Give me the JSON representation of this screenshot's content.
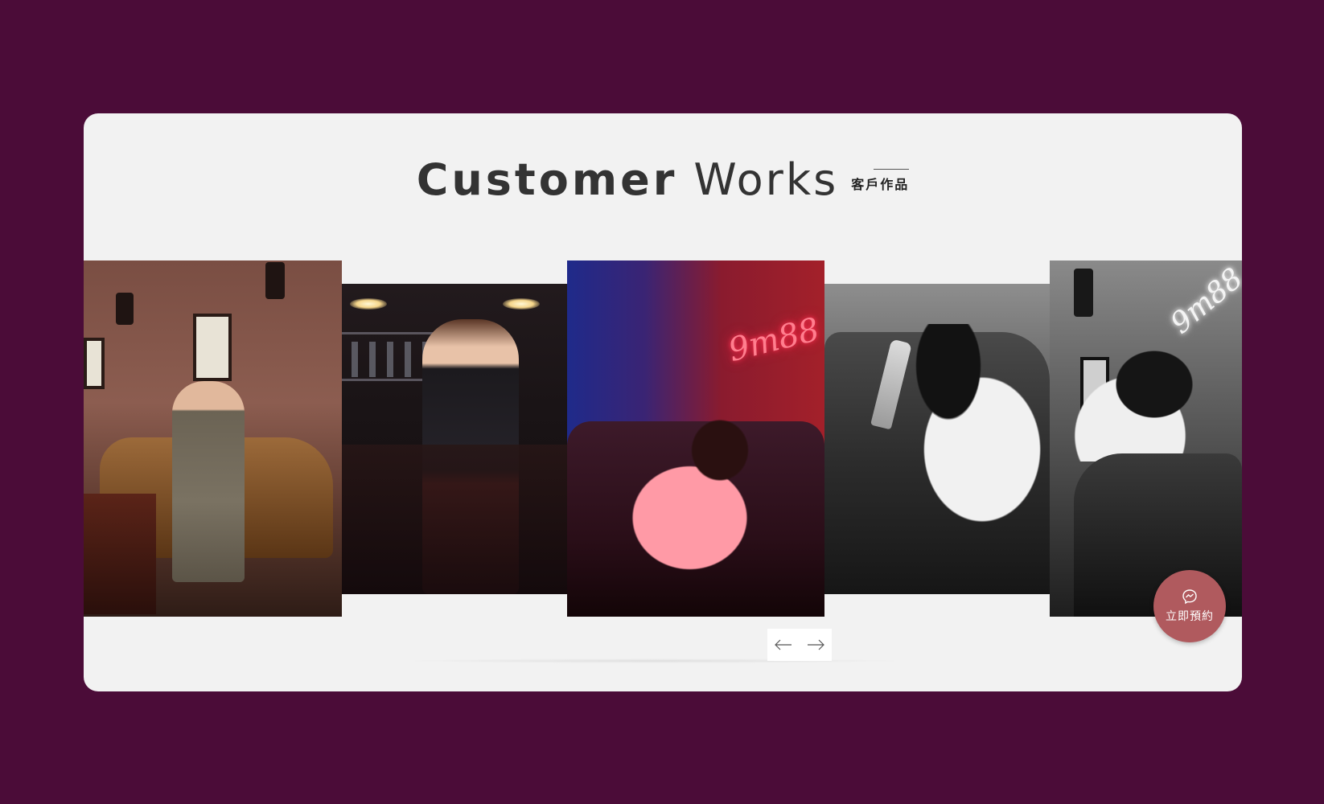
{
  "section": {
    "title_bold": "Customer",
    "title_light": "Works",
    "subtitle": "客戶作品"
  },
  "gallery": {
    "photos": [
      {
        "name": "photo-man-in-suit",
        "tone": "warm-brown"
      },
      {
        "name": "photo-woman-at-bar",
        "tone": "dark"
      },
      {
        "name": "photo-woman-on-sofa-red",
        "tone": "red-blue"
      },
      {
        "name": "photo-woman-with-bottle",
        "tone": "black-and-white"
      },
      {
        "name": "photo-woman-leaning-bw",
        "tone": "black-and-white"
      }
    ],
    "neon_sign_text": "9m88"
  },
  "navigation": {
    "prev_icon": "arrow-left-icon",
    "next_icon": "arrow-right-icon"
  },
  "fab": {
    "icon": "messenger-icon",
    "label": "立即預約"
  },
  "colors": {
    "page_background": "#4b0c38",
    "panel_background": "#f2f2f2",
    "fab_background": "#b05a5e"
  }
}
